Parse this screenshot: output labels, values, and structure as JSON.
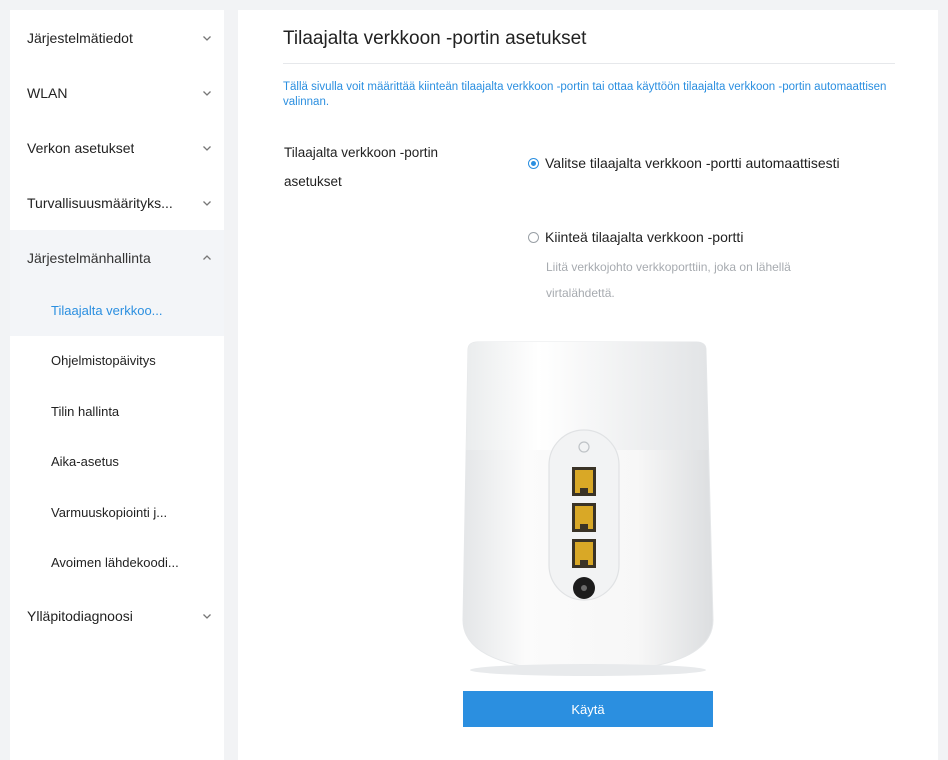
{
  "sidebar": {
    "items": [
      {
        "label": "Järjestelmätiedot"
      },
      {
        "label": "WLAN"
      },
      {
        "label": "Verkon asetukset"
      },
      {
        "label": "Turvallisuusmäärityks..."
      },
      {
        "label": "Järjestelmänhallinta"
      },
      {
        "label": "Ylläpitodiagnoosi"
      }
    ],
    "subitems": [
      {
        "label": "Tilaajalta verkkoo..."
      },
      {
        "label": "Ohjelmistopäivitys"
      },
      {
        "label": "Tilin hallinta"
      },
      {
        "label": "Aika-asetus"
      },
      {
        "label": "Varmuuskopiointi j..."
      },
      {
        "label": "Avoimen lähdekoodi..."
      }
    ]
  },
  "main": {
    "title": "Tilaajalta verkkoon -portin asetukset",
    "description": "Tällä sivulla voit määrittää kiinteän tilaajalta verkkoon -portin tai ottaa käyttöön tilaajalta verkkoon -portin automaattisen valinnan.",
    "field_label": "Tilaajalta verkkoon -portin asetukset",
    "option_auto": "Valitse tilaajalta verkkoon -portti automaattisesti",
    "option_fixed": "Kiinteä tilaajalta verkkoon -portti",
    "hint": "Liitä verkkojohto verkkoporttiin, joka on lähellä virtalähdettä.",
    "apply_label": "Käytä",
    "selected_option": "auto"
  },
  "colors": {
    "accent": "#2b8fe0",
    "port": "#d9a826"
  }
}
